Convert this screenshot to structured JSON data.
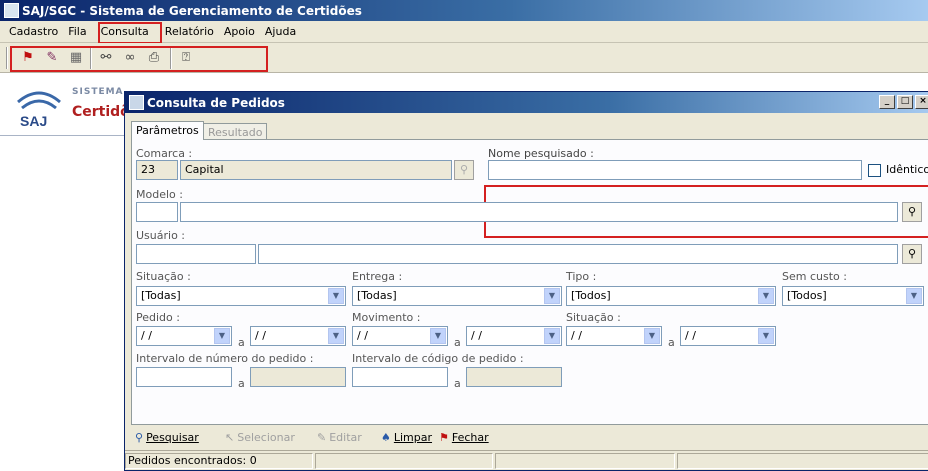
{
  "app": {
    "title": "SAJ/SGC - Sistema de Gerenciamento de Certidões"
  },
  "menu": {
    "items": [
      "Cadastro",
      "Fila",
      "Consulta",
      "Relatório",
      "Apoio",
      "Ajuda"
    ]
  },
  "toolbar": {
    "icons": [
      "flag-icon",
      "tools-icon",
      "building-icon",
      "relation-icon",
      "link-icon",
      "print-icon",
      "help-icon"
    ]
  },
  "brand": {
    "line1": "SISTEMA",
    "line2": "Certidõ",
    "logo_text": "SAJ"
  },
  "dialog": {
    "title": "Consulta de Pedidos",
    "window_buttons": [
      "_",
      "□",
      "×"
    ],
    "tabs": [
      "Parâmetros",
      "Resultado"
    ],
    "fields": {
      "comarca": {
        "label": "Comarca :",
        "code": "23",
        "name": "Capital"
      },
      "nome": {
        "label": "Nome pesquisado :",
        "value": "",
        "identico": "Idêntico"
      },
      "modelo": {
        "label": "Modelo :",
        "code": "",
        "name": ""
      },
      "usuario": {
        "label": "Usuário :",
        "code": "",
        "name": ""
      },
      "situacao": {
        "label": "Situação :",
        "value": "[Todas]"
      },
      "entrega": {
        "label": "Entrega :",
        "value": "[Todas]"
      },
      "tipo": {
        "label": "Tipo :",
        "value": "[Todos]"
      },
      "sem_custo": {
        "label": "Sem custo :",
        "value": "[Todos]"
      },
      "pedido": {
        "label": "Pedido :",
        "from": "/ /",
        "to": "/ /"
      },
      "movimento": {
        "label": "Movimento :",
        "from": "/ /",
        "to": "/ /"
      },
      "situacao2": {
        "label": "Situação :",
        "from": "/ /",
        "to": "/ /"
      },
      "intervalo_numero": {
        "label": "Intervalo de número do pedido :"
      },
      "intervalo_codigo": {
        "label": "Intervalo de código de pedido :"
      },
      "range_sep": "a"
    },
    "actions": {
      "pesquisar": "Pesquisar",
      "selecionar": "Selecionar",
      "editar": "Editar",
      "limpar": "Limpar",
      "fechar": "Fechar"
    },
    "status": {
      "found": "Pedidos encontrados: 0"
    }
  },
  "colors": {
    "highlight": "#d42020",
    "titlebar": "#0a246a"
  }
}
